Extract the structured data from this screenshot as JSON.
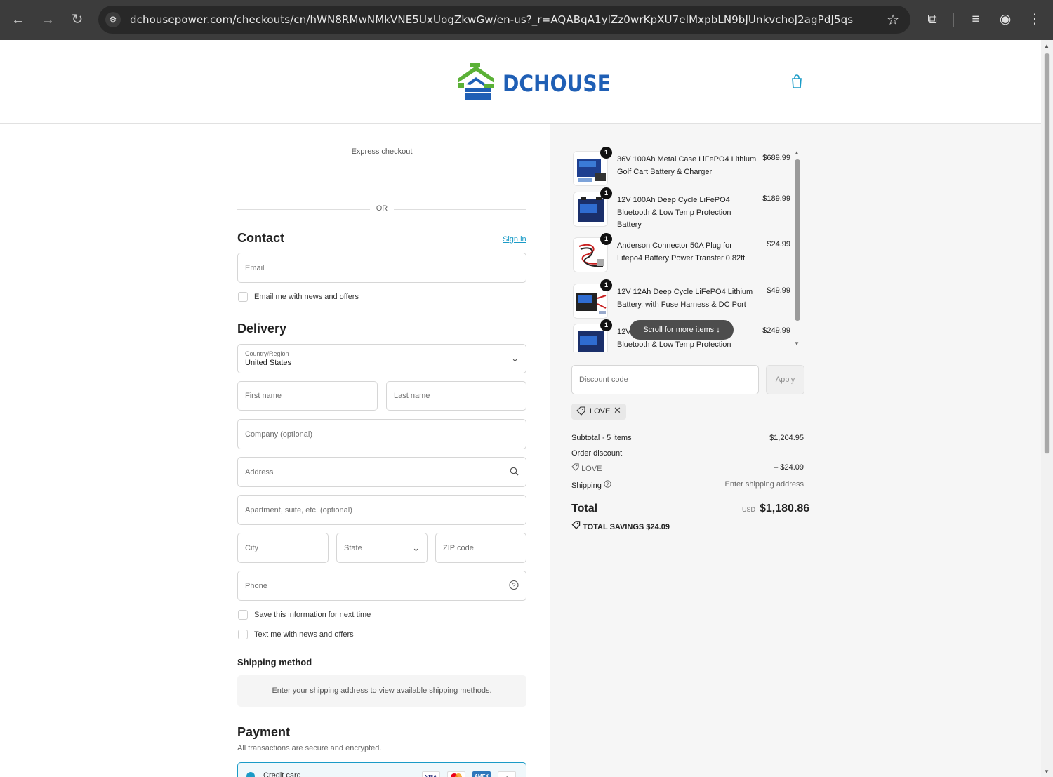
{
  "browser": {
    "url": "dchousepower.com/checkouts/cn/hWN8RMwNMkVNE5UxUogZkwGw/en-us?_r=AQABqA1ylZz0wrKpXU7eIMxpbLN9bJUnkvchoJ2agPdJ5qs"
  },
  "header": {
    "logo_text": "DCHOUSE",
    "brand_colors": {
      "green": "#5bb137",
      "blue": "#1f5fb5"
    }
  },
  "express": {
    "label": "Express checkout",
    "or": "OR"
  },
  "contact": {
    "title": "Contact",
    "sign_in": "Sign in",
    "email_placeholder": "Email",
    "news_label": "Email me with news and offers"
  },
  "delivery": {
    "title": "Delivery",
    "country_label": "Country/Region",
    "country_value": "United States",
    "first_name": "First name",
    "last_name": "Last name",
    "company": "Company (optional)",
    "address": "Address",
    "apartment": "Apartment, suite, etc. (optional)",
    "city": "City",
    "state": "State",
    "zip": "ZIP code",
    "phone": "Phone",
    "save_info": "Save this information for next time",
    "text_me": "Text me with news and offers"
  },
  "shipping_method": {
    "title": "Shipping method",
    "message": "Enter your shipping address to view available shipping methods."
  },
  "payment": {
    "title": "Payment",
    "subtitle": "All transactions are secure and encrypted.",
    "method": "Credit card",
    "card_logos": [
      "VISA",
      "MC",
      "AMEX"
    ]
  },
  "cart": {
    "items": [
      {
        "qty": "1",
        "name": "36V 100Ah Metal Case LiFePO4 Lithium Golf Cart Battery & Charger",
        "price": "$689.99"
      },
      {
        "qty": "1",
        "name": "12V 100Ah Deep Cycle LiFePO4 Bluetooth & Low Temp Protection Battery",
        "price": "$189.99"
      },
      {
        "qty": "1",
        "name": "Anderson Connector 50A Plug for Lifepo4 Battery Power Transfer 0.82ft",
        "price": "$24.99"
      },
      {
        "qty": "1",
        "name": "12V 12Ah Deep Cycle LiFePO4 Lithium Battery, with Fuse Harness & DC Port",
        "price": "$49.99"
      },
      {
        "qty": "1",
        "name": "12V 100Ah Deep Cycle LiFePO4 Bluetooth & Low Temp Protection",
        "price": "$249.99"
      }
    ],
    "scroll_hint": "Scroll for more items"
  },
  "discount": {
    "placeholder": "Discount code",
    "apply": "Apply",
    "applied_code": "LOVE"
  },
  "summary": {
    "subtotal_label": "Subtotal · 5 items",
    "subtotal_value": "$1,204.95",
    "order_discount_label": "Order discount",
    "discount_code": "LOVE",
    "discount_value": "– $24.09",
    "shipping_label": "Shipping",
    "shipping_value": "Enter shipping address",
    "total_label": "Total",
    "currency": "USD",
    "total_value": "$1,180.86",
    "savings_label": "TOTAL SAVINGS",
    "savings_value": "$24.09"
  }
}
